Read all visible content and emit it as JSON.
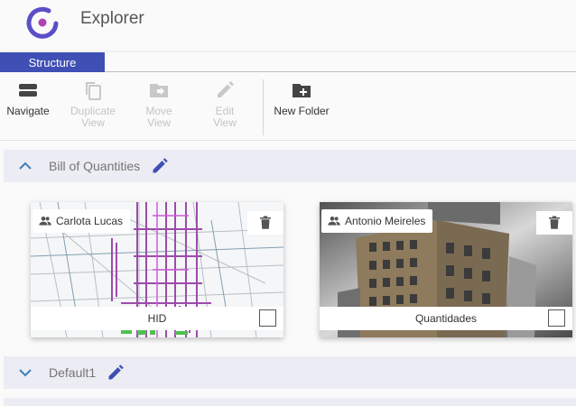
{
  "app": {
    "title": "Explorer",
    "accent_color": "#3f4fb4",
    "logo_icon": "app-logo-icon"
  },
  "tabs": [
    {
      "label": "Structure",
      "active": true
    }
  ],
  "toolbar": {
    "navigate": {
      "label": "Navigate",
      "icon": "navigate-icon",
      "enabled": true
    },
    "duplicate_view": {
      "label": "Duplicate View",
      "icon": "duplicate-icon",
      "enabled": false
    },
    "move_view": {
      "label": "Move View",
      "icon": "move-folder-icon",
      "enabled": false
    },
    "edit_view": {
      "label": "Edit View",
      "icon": "pencil-icon",
      "enabled": false
    },
    "new_folder": {
      "label": "New Folder",
      "icon": "new-folder-icon",
      "enabled": true
    }
  },
  "groups": [
    {
      "name": "Bill of Quantities",
      "expanded": true,
      "cards": [
        {
          "owner": "Carlota Lucas",
          "title": "HID",
          "checked": false
        },
        {
          "owner": "Antonio Meireles",
          "title": "Quantidades",
          "checked": false
        }
      ]
    },
    {
      "name": "Default1",
      "expanded": false,
      "cards": []
    }
  ]
}
